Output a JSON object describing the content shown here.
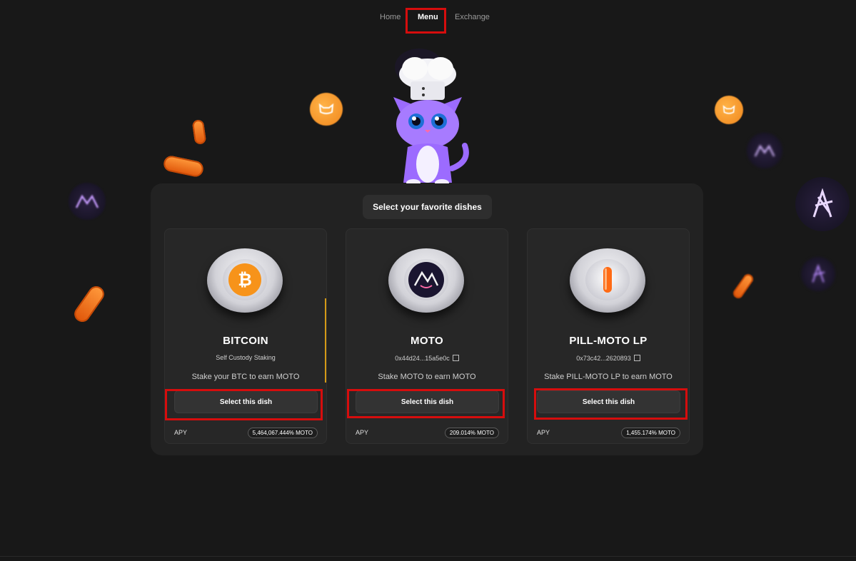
{
  "nav": {
    "items": [
      {
        "label": "Home",
        "active": false
      },
      {
        "label": "Menu",
        "active": true
      },
      {
        "label": "Exchange",
        "active": false
      }
    ]
  },
  "panel": {
    "title": "Select your favorite dishes"
  },
  "cards": [
    {
      "name": "BITCOIN",
      "subtitle": "Self Custody Staking",
      "description": "Stake your BTC to earn MOTO",
      "button_label": "Select this dish",
      "apy_label": "APY",
      "apy_value": "5,464,067.444% MOTO",
      "icon": "bitcoin-icon"
    },
    {
      "name": "MOTO",
      "subtitle": "0x44d24...15a5e0c",
      "description": "Stake MOTO to earn MOTO",
      "button_label": "Select this dish",
      "apy_label": "APY",
      "apy_value": "209.014% MOTO",
      "icon": "moto-icon"
    },
    {
      "name": "PILL-MOTO LP",
      "subtitle": "0x73c42...2620893",
      "description": "Stake PILL-MOTO LP to earn MOTO",
      "button_label": "Select this dish",
      "apy_label": "APY",
      "apy_value": "1,455.174% MOTO",
      "icon": "pill-icon"
    }
  ],
  "colors": {
    "background": "#181818",
    "panel": "#222222",
    "card": "#272727",
    "highlight": "#d60d0d",
    "bitcoin": "#f7931a",
    "moto_purple": "#9b59ff"
  }
}
